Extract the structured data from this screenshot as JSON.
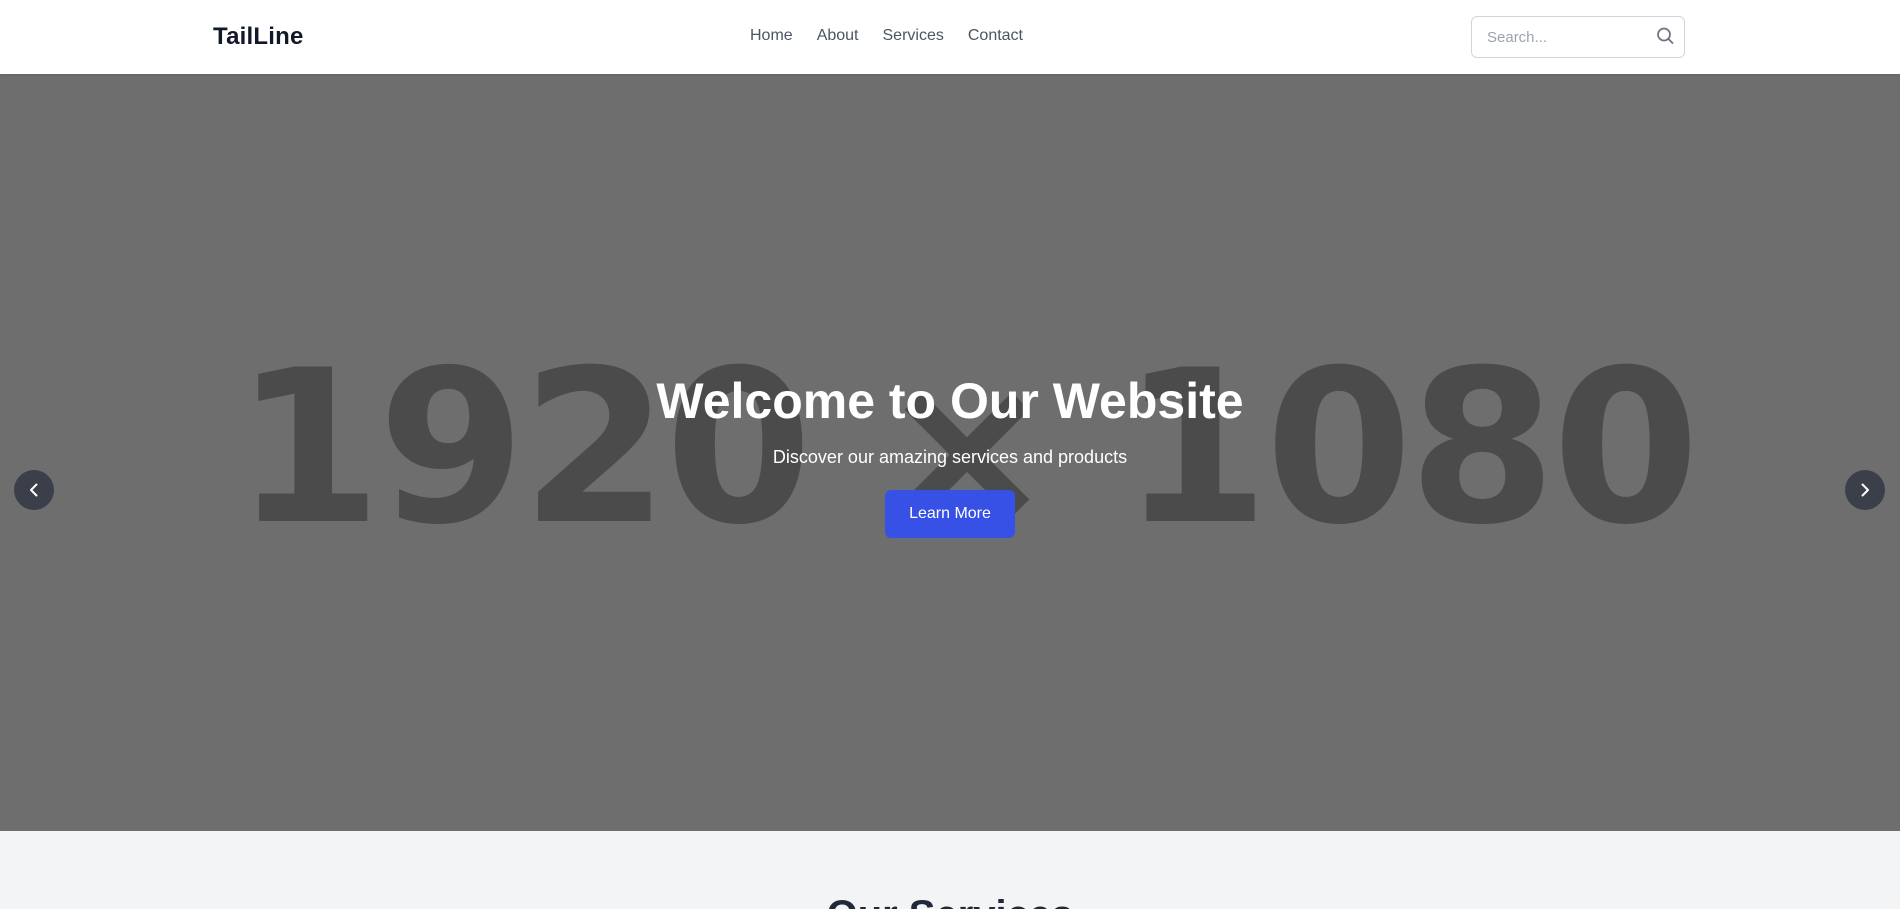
{
  "brand": {
    "name": "TailLine"
  },
  "nav": {
    "links": [
      {
        "label": "Home"
      },
      {
        "label": "About"
      },
      {
        "label": "Services"
      },
      {
        "label": "Contact"
      }
    ]
  },
  "search": {
    "placeholder": "Search...",
    "value": "",
    "icon": "search-icon"
  },
  "hero": {
    "placeholder_image_text": "1920 × 1080",
    "title": "Welcome to Our Website",
    "subtitle": "Discover our amazing services and products",
    "cta_label": "Learn More",
    "prev_icon": "chevron-left-icon",
    "next_icon": "chevron-right-icon"
  },
  "services": {
    "heading": "Our Services"
  },
  "colors": {
    "navbar_bg": "#ffffff",
    "hero_bg": "#6e6e6e",
    "cta_bg": "#3751e6",
    "arrow_bg": "#3b3f4a",
    "section_bg": "#f3f4f6"
  }
}
